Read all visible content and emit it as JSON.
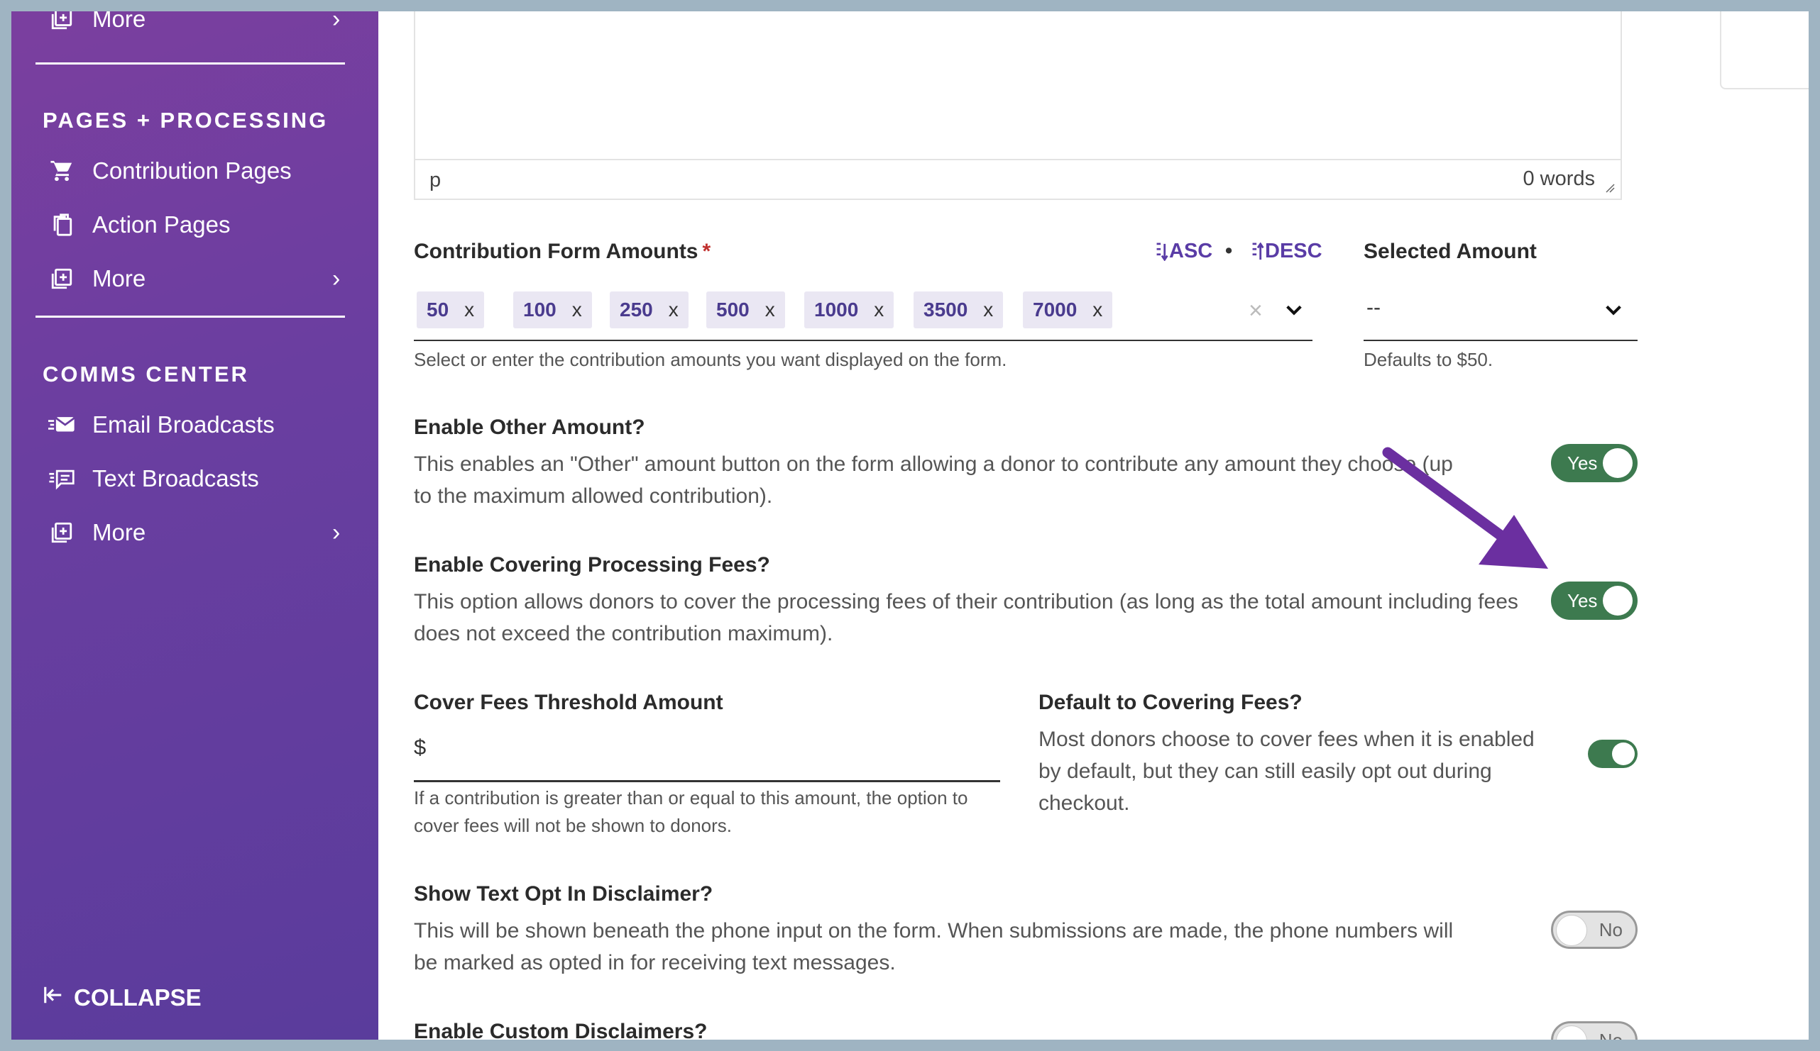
{
  "sidebar": {
    "top_more_label": "More",
    "section1_heading": "PAGES + PROCESSING",
    "section1_items": [
      {
        "label": "Contribution Pages",
        "icon": "cart-icon"
      },
      {
        "label": "Action Pages",
        "icon": "clipboard-icon"
      },
      {
        "label": "More",
        "icon": "add-page-icon"
      }
    ],
    "section2_heading": "COMMS CENTER",
    "section2_items": [
      {
        "label": "Email Broadcasts",
        "icon": "email-icon"
      },
      {
        "label": "Text Broadcasts",
        "icon": "text-message-icon"
      },
      {
        "label": "More",
        "icon": "add-page-icon"
      }
    ],
    "collapse_label": "COLLAPSE"
  },
  "editor": {
    "element_path": "p",
    "word_count": "0 words"
  },
  "amounts": {
    "label": "Contribution Form Amounts",
    "required_mark": "*",
    "sort_asc": "ASC",
    "sort_sep": "•",
    "sort_desc": "DESC",
    "chips": [
      "50",
      "100",
      "250",
      "500",
      "1000",
      "3500",
      "7000"
    ],
    "chip_remove": "x",
    "clear": "×",
    "hint": "Select or enter the contribution amounts you want displayed on the form."
  },
  "selected_amount": {
    "label": "Selected Amount",
    "value": "--",
    "hint": "Defaults to $50."
  },
  "other_amount": {
    "label": "Enable Other Amount?",
    "desc": "This enables an \"Other\" amount button on the form allowing a donor to contribute any amount they choose (up to the maximum allowed contribution).",
    "toggle_label": "Yes"
  },
  "covering_fees": {
    "label": "Enable Covering Processing Fees?",
    "desc": "This option allows donors to cover the processing fees of their contribution (as long as the total amount including fees does not exceed the contribution maximum).",
    "toggle_label": "Yes"
  },
  "threshold": {
    "label": "Cover Fees Threshold Amount",
    "prefix": "$",
    "value": "",
    "hint": "If a contribution is greater than or equal to this amount, the option to cover fees will not be shown to donors."
  },
  "default_covering": {
    "label": "Default to Covering Fees?",
    "desc": "Most donors choose to cover fees when it is enabled by default, but they can still easily opt out during checkout."
  },
  "text_opt_in": {
    "label": "Show Text Opt In Disclaimer?",
    "desc": "This will be shown beneath the phone input on the form. When submissions are made, the phone numbers will be marked as opted in for receiving text messages.",
    "toggle_label": "No"
  },
  "custom_disclaimers": {
    "label": "Enable Custom Disclaimers?",
    "toggle_label": "No"
  },
  "colors": {
    "accent_purple": "#5a3ca6",
    "toggle_on": "#3d7a4f",
    "annotation_arrow": "#6b2fa0"
  }
}
